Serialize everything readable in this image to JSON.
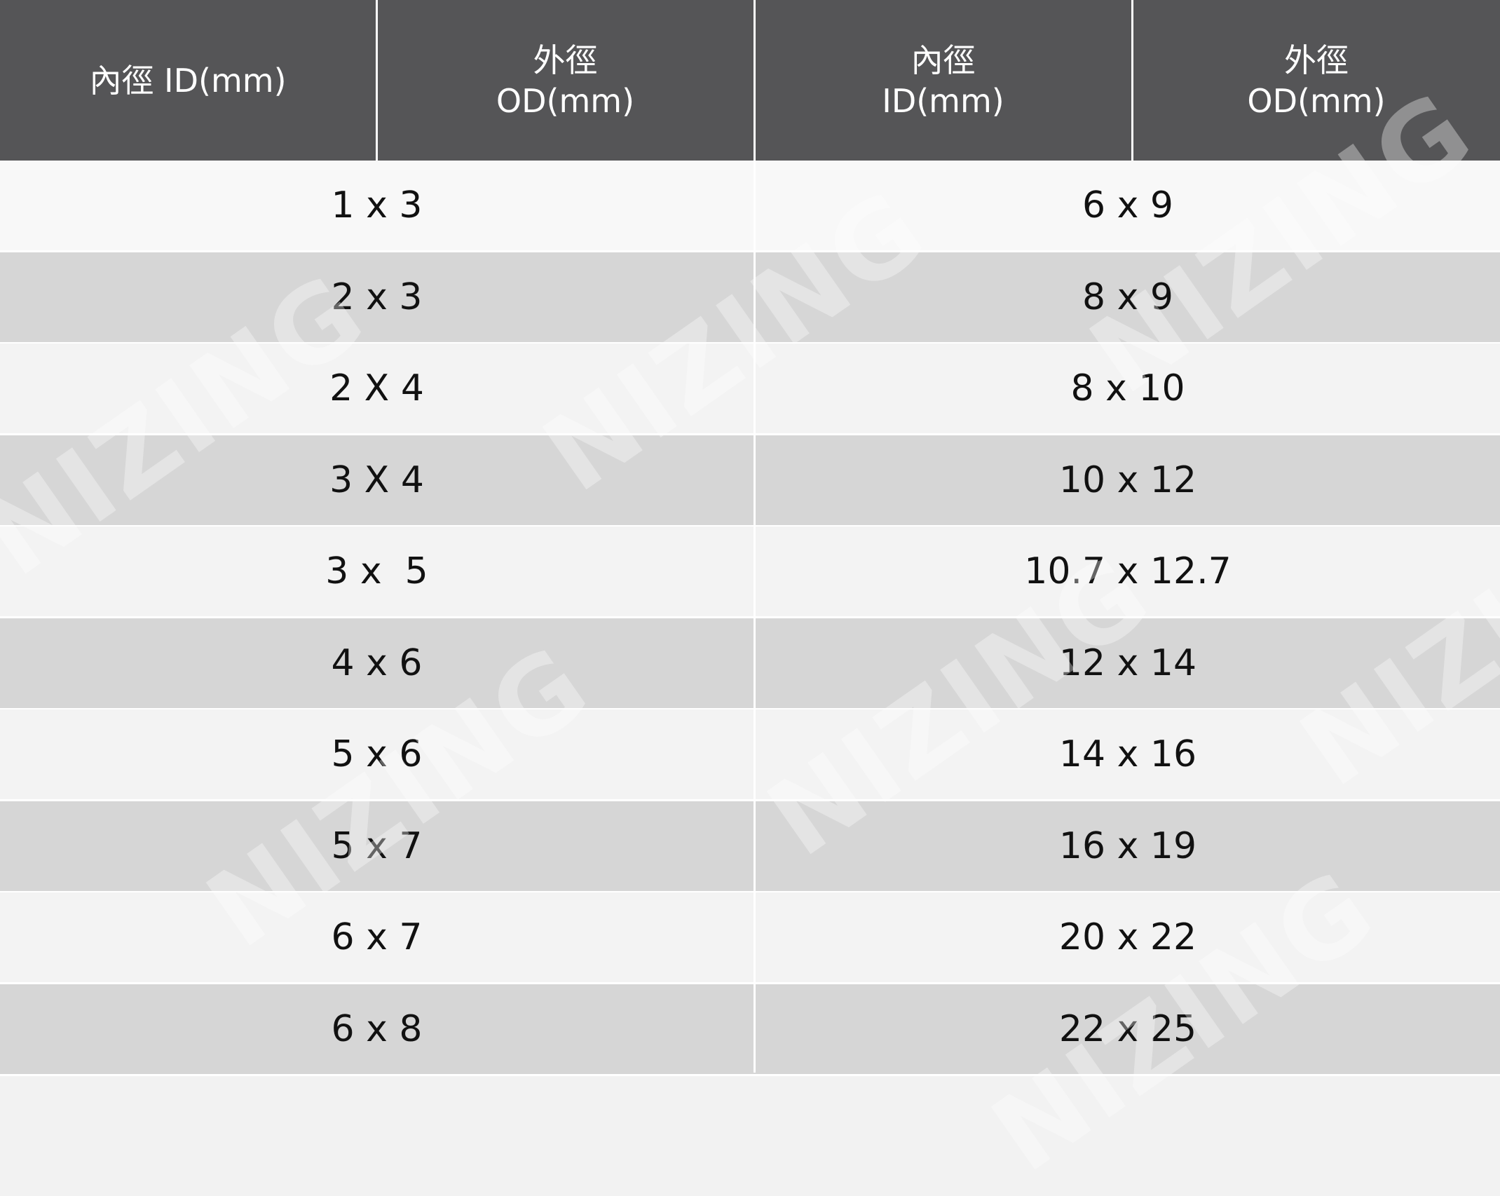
{
  "header": {
    "col1": {
      "line1": "內徑 ID(mm)"
    },
    "col2": {
      "line1": "外徑",
      "line2": "OD(mm)"
    },
    "col3": {
      "line1": "內徑",
      "line2": "ID(mm)"
    },
    "col4": {
      "line1": "外徑",
      "line2": "OD(mm)"
    }
  },
  "rows": [
    {
      "left": "1 x 3",
      "right": "6 x 9"
    },
    {
      "left": "2 x 3",
      "right": "8 x 9"
    },
    {
      "left": "2 X 4",
      "right": "8 x 10"
    },
    {
      "left": "3 X 4",
      "right": "10 x 12"
    },
    {
      "left": "3 x  5",
      "right": "10.7 x 12.7"
    },
    {
      "left": "4 x 6",
      "right": "12 x 14"
    },
    {
      "left": "5 x 6",
      "right": "14 x 16"
    },
    {
      "left": "5 x 7",
      "right": "16 x 19"
    },
    {
      "left": "6 x 7",
      "right": "20 x 22"
    },
    {
      "left": "6 x 8",
      "right": "22 x 25"
    }
  ],
  "watermark": "NIZING",
  "colors": {
    "header_bg": "#555557",
    "row_light": "#f3f3f3",
    "row_dark": "#d6d6d6",
    "text": "#111111"
  }
}
